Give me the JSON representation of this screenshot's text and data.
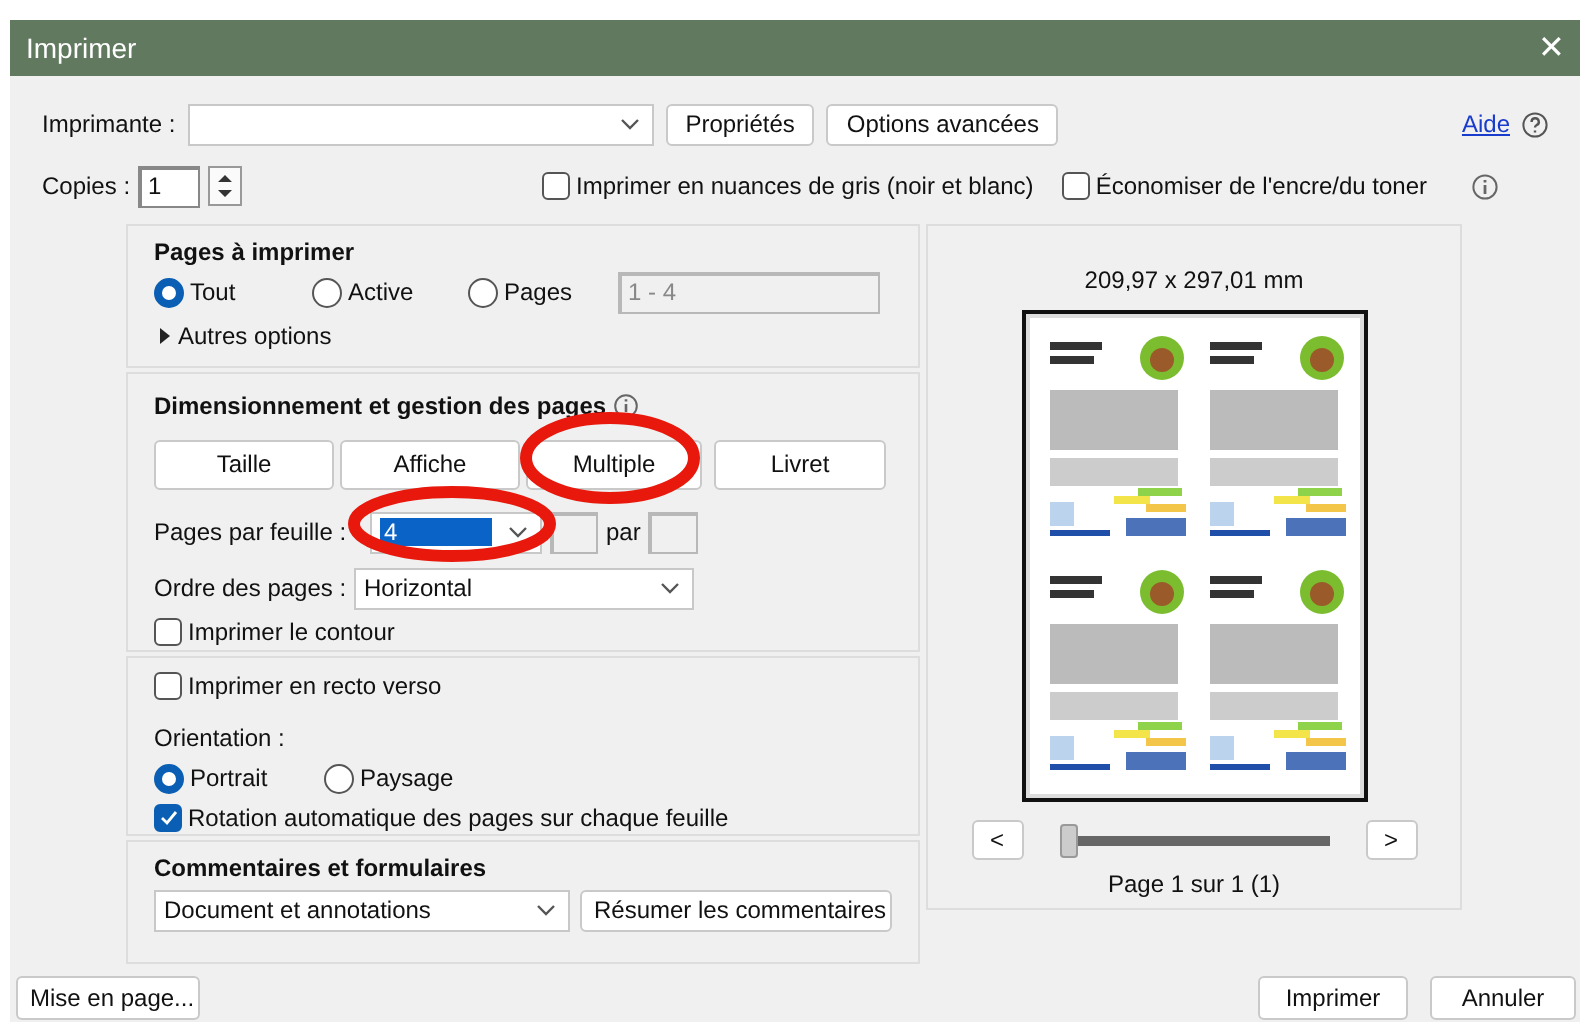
{
  "window": {
    "title": "Imprimer",
    "close": "✕"
  },
  "printer": {
    "label": "Imprimante :",
    "buttons": [
      "Propriétés",
      "Options avancées"
    ],
    "help": "Aide"
  },
  "copies": {
    "label": "Copies :",
    "value": "1"
  },
  "top_options": [
    {
      "label": "Imprimer en nuances de gris (noir et blanc)",
      "checked": false
    },
    {
      "label": "Économiser de l'encre/du toner",
      "checked": false
    }
  ],
  "pages_to_print": {
    "title": "Pages à imprimer",
    "options": [
      {
        "label": "Tout",
        "selected": true
      },
      {
        "label": "Active",
        "selected": false
      },
      {
        "label": "Pages",
        "selected": false
      }
    ],
    "range": "1 - 4",
    "more": "Autres options"
  },
  "sizing": {
    "title": "Dimensionnement et gestion des pages",
    "modes": [
      "Taille",
      "Affiche",
      "Multiple",
      "Livret"
    ],
    "per_sheet_label": "Pages par feuille :",
    "per_sheet": "4",
    "by": "par",
    "order_label": "Ordre des pages :",
    "order": "Horizontal",
    "border": {
      "label": "Imprimer le contour",
      "checked": false
    }
  },
  "duplex": {
    "label": "Imprimer en recto verso",
    "checked": false
  },
  "orientation": {
    "label": "Orientation :",
    "options": [
      {
        "label": "Portrait",
        "selected": true
      },
      {
        "label": "Paysage",
        "selected": false
      }
    ],
    "auto_rotate": {
      "label": "Rotation automatique des pages sur chaque feuille",
      "checked": true
    }
  },
  "comments": {
    "title": "Commentaires et formulaires",
    "value": "Document et annotations",
    "button": "Résumer les commentaires"
  },
  "preview": {
    "size": "209,97 x 297,01 mm",
    "prev": "<",
    "next": ">",
    "level": 0,
    "page": "Page 1 sur 1 (1)"
  },
  "footer": {
    "setup": "Mise en page...",
    "buttons": [
      "Imprimer",
      "Annuler"
    ]
  }
}
